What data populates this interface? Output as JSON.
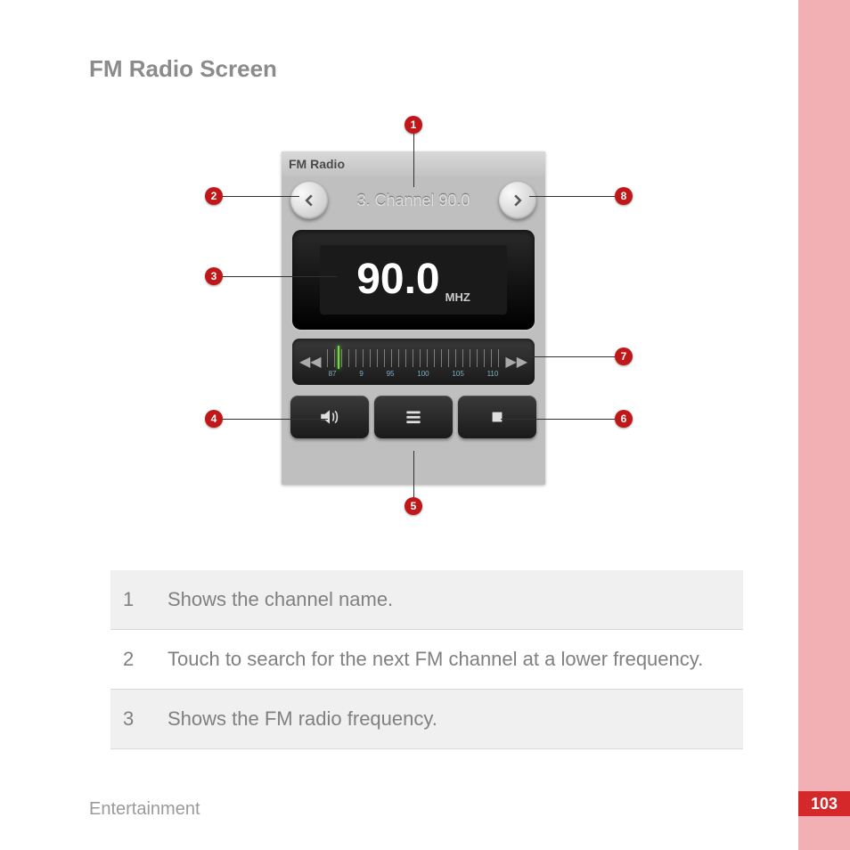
{
  "page": {
    "title": "FM Radio Screen",
    "footer": "Entertainment",
    "number": "103"
  },
  "radio": {
    "app_title": "FM Radio",
    "channel_name": "3. Channel 90.0",
    "frequency": "90.0",
    "unit": "MHZ",
    "tick_labels": [
      "87",
      "9",
      "95",
      "100",
      "105",
      "110"
    ]
  },
  "callouts": {
    "c1": "1",
    "c2": "2",
    "c3": "3",
    "c4": "4",
    "c5": "5",
    "c6": "6",
    "c7": "7",
    "c8": "8"
  },
  "descriptions": [
    {
      "num": "1",
      "text": "Shows the channel name."
    },
    {
      "num": "2",
      "text": "Touch to search for the next FM channel at a lower frequency."
    },
    {
      "num": "3",
      "text": "Shows the FM radio frequency."
    }
  ]
}
